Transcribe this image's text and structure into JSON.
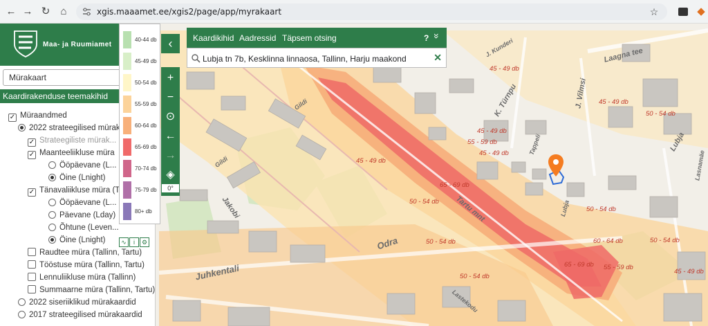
{
  "browser": {
    "back": "←",
    "forward": "→",
    "reload": "↻",
    "home": "⌂",
    "url": "xgis.maaamet.ee/xgis2/page/app/myrakaart"
  },
  "brand": {
    "name": "Maa- ja Ruumiamet"
  },
  "sidebar": {
    "select_value": "Mürakaart",
    "select_icon": "chevron-down-icon",
    "themes_header": "Kaardirakenduse teemakihid",
    "tree": [
      {
        "label": "Müraandmed",
        "type": "checkbox",
        "checked": true,
        "level": 0
      },
      {
        "label": "2022 strateegilised mürak...",
        "type": "radio",
        "checked": true,
        "level": 1
      },
      {
        "label": "Strateegiliste mürak...",
        "type": "checkbox",
        "checked": true,
        "level": 2,
        "muted": true
      },
      {
        "label": "Maanteeliikluse müra",
        "type": "checkbox",
        "checked": true,
        "level": 2
      },
      {
        "label": "Ööpäevane (L...",
        "type": "radio",
        "checked": false,
        "level": 3
      },
      {
        "label": "Öine (Lnight)",
        "type": "radio",
        "checked": true,
        "level": 3
      },
      {
        "label": "Tänavaliikluse müra (Ta",
        "type": "checkbox",
        "checked": true,
        "level": 2
      },
      {
        "label": "Ööpäevane (L...",
        "type": "radio",
        "checked": false,
        "level": 3
      },
      {
        "label": "Päevane (Lday)",
        "type": "radio",
        "checked": false,
        "level": 3
      },
      {
        "label": "Õhtune (Leven...",
        "type": "radio",
        "checked": false,
        "level": 3
      },
      {
        "label": "Öine (Lnight)",
        "type": "radio",
        "checked": true,
        "level": 3
      },
      {
        "label": "Raudtee müra (Tallinn, Tartu)",
        "type": "checkbox",
        "checked": false,
        "level": 2
      },
      {
        "label": "Tööstuse müra (Tallinn, Tartu)",
        "type": "checkbox",
        "checked": false,
        "level": 2
      },
      {
        "label": "Lennuliikluse müra (Tallinn)",
        "type": "checkbox",
        "checked": false,
        "level": 2
      },
      {
        "label": "Summaarne müra (Tallinn, Tartu)",
        "type": "checkbox",
        "checked": false,
        "level": 2
      },
      {
        "label": "2022 siseriiklikud mürakaardid",
        "type": "radio",
        "checked": false,
        "level": 1
      },
      {
        "label": "2017 strateegilised mürakaardid",
        "type": "radio",
        "checked": false,
        "level": 1
      }
    ]
  },
  "legend": [
    {
      "label": "40-44 db",
      "color": "#b8e0b0"
    },
    {
      "label": "45-49 db",
      "color": "#d8efc8"
    },
    {
      "label": "50-54 db",
      "color": "#fff6c8"
    },
    {
      "label": "55-59 db",
      "color": "#fcd39a"
    },
    {
      "label": "60-64 db",
      "color": "#f8b07a"
    },
    {
      "label": "65-69 db",
      "color": "#f06a6a"
    },
    {
      "label": "70-74 db",
      "color": "#d0668a"
    },
    {
      "label": "75-79 db",
      "color": "#b070a8"
    },
    {
      "label": "80+ db",
      "color": "#8a78b8"
    }
  ],
  "search": {
    "tabs": [
      "Kaardikihid",
      "Aadressid",
      "Täpsem otsing"
    ],
    "help": "?",
    "collapse": "»",
    "query": "Lubja tn 7b, Kesklinna linnaosa, Tallinn, Harju maakond",
    "clear": "✕"
  },
  "tools": {
    "collapse": "‹",
    "zoom_in": "+",
    "zoom_out": "−",
    "locate": "⊙",
    "back": "←",
    "forward": "→",
    "compass": "◈",
    "rotation": "0°"
  },
  "map": {
    "noise_labels": [
      "45 - 49 db",
      "45 - 49 db",
      "45 - 49 db",
      "50 - 54 db",
      "55 - 59 db",
      "45 - 49 db",
      "65 - 69 db",
      "50 - 54 db",
      "45 - 49 db",
      "50 - 54 db",
      "60 - 64 db",
      "65 - 69 db",
      "55 - 59 db",
      "50 - 54 db",
      "50 - 54 db",
      "45 - 49 db",
      "50 - 54 db"
    ],
    "streets": [
      "Laagna tee",
      "J. Vilmsi",
      "K. Türnpu",
      "Lubja",
      "J. Kunderi",
      "Tartu mnt",
      "Odra",
      "Juhkentali",
      "Jakobi",
      "Gildi",
      "Lastekodu",
      "Lubja",
      "Lasnamäe",
      "Tappeli",
      "Gildi"
    ],
    "colors": {
      "accent": "#2e7d4a",
      "marker": "#f57c20"
    }
  }
}
